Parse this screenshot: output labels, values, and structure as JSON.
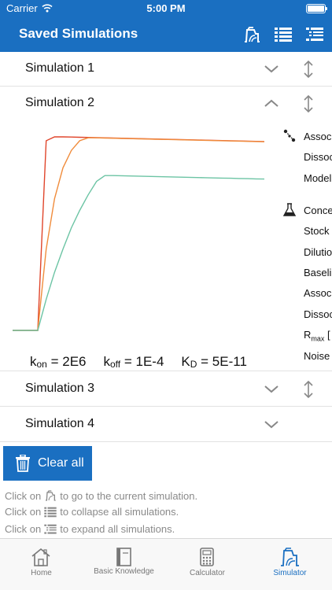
{
  "status_bar": {
    "carrier": "Carrier",
    "time": "5:00 PM",
    "battery_level": 1.0
  },
  "nav": {
    "title": "Saved Simulations",
    "icons": [
      "simulation-icon",
      "collapse-list-icon",
      "expand-list-icon"
    ]
  },
  "simulations": [
    {
      "label": "Simulation 1",
      "expanded": false
    },
    {
      "label": "Simulation 2",
      "expanded": true
    },
    {
      "label": "Simulation 3",
      "expanded": false
    },
    {
      "label": "Simulation 4",
      "expanded": false
    }
  ],
  "kinetics": {
    "kon_prefix": "k",
    "kon_sub": "on",
    "kon_value": " = 2E6",
    "koff_prefix": "k",
    "koff_sub": "off",
    "koff_value": " = 1E-4",
    "kd_prefix": "K",
    "kd_sub": "D",
    "kd_value": " = 5E-11"
  },
  "params": {
    "group1": [
      "Assoc",
      "Dissoc",
      "Model"
    ],
    "group2": [
      "Conce",
      "Stock",
      "Dilutio",
      "Baseli",
      "Assoc",
      "Dissoc",
      "R",
      "Noise"
    ],
    "rmax_sub": "max",
    "rmax_tail": " [",
    "group1_icon": "molecule-icon",
    "group2_icon": "flask-icon"
  },
  "clear_all": {
    "label": "Clear all",
    "icon": "trash-icon"
  },
  "hints": [
    {
      "prefix": "Click on",
      "icon": "simulation-icon",
      "suffix": "to go to the current simulation."
    },
    {
      "prefix": "Click on",
      "icon": "collapse-list-icon",
      "suffix": "to collapse all simulations."
    },
    {
      "prefix": "Click on",
      "icon": "expand-list-icon",
      "suffix": "to expand all simulations."
    }
  ],
  "tabs": [
    {
      "label": "Home",
      "icon": "home-icon",
      "active": false
    },
    {
      "label": "Basic Knowledge",
      "icon": "book-icon",
      "active": false
    },
    {
      "label": "Calculator",
      "icon": "calculator-icon",
      "active": false
    },
    {
      "label": "Simulator",
      "icon": "simulator-icon",
      "active": true
    }
  ],
  "colors": {
    "primary": "#1a6fc1",
    "curve_red": "#e0452b",
    "curve_orange": "#f08c3c",
    "curve_green": "#6cc4a4"
  },
  "chart_data": {
    "type": "line",
    "xlabel": "",
    "ylabel": "",
    "grid": false,
    "x": [
      0,
      1,
      2,
      3,
      4,
      5,
      6,
      7,
      8,
      9,
      10,
      11,
      12,
      13,
      14,
      15,
      16,
      17,
      18,
      19,
      20,
      21,
      22,
      23,
      24,
      25,
      26,
      27,
      28,
      29,
      30
    ],
    "series": [
      {
        "color": "#e0452b",
        "values": [
          0,
          0,
          0,
          0,
          0.98,
          1.0,
          1.0,
          0.999,
          0.998,
          0.997,
          0.996,
          0.995,
          0.994,
          0.993,
          0.992,
          0.991,
          0.99,
          0.989,
          0.988,
          0.987,
          0.986,
          0.985,
          0.984,
          0.983,
          0.982,
          0.981,
          0.98,
          0.979,
          0.978,
          0.977,
          0.976
        ]
      },
      {
        "color": "#f08c3c",
        "values": [
          0,
          0,
          0,
          0,
          0.42,
          0.68,
          0.84,
          0.93,
          0.98,
          0.995,
          0.995,
          0.994,
          0.993,
          0.992,
          0.991,
          0.99,
          0.989,
          0.988,
          0.987,
          0.986,
          0.985,
          0.984,
          0.983,
          0.982,
          0.981,
          0.98,
          0.979,
          0.978,
          0.977,
          0.976,
          0.975
        ]
      },
      {
        "color": "#6cc4a4",
        "values": [
          0,
          0,
          0,
          0,
          0.16,
          0.3,
          0.42,
          0.53,
          0.62,
          0.7,
          0.77,
          0.8,
          0.8,
          0.799,
          0.798,
          0.797,
          0.796,
          0.795,
          0.794,
          0.793,
          0.792,
          0.791,
          0.79,
          0.789,
          0.788,
          0.787,
          0.786,
          0.785,
          0.784,
          0.783,
          0.782
        ]
      }
    ],
    "xlim": [
      0,
      30
    ],
    "ylim": [
      0,
      1
    ]
  }
}
